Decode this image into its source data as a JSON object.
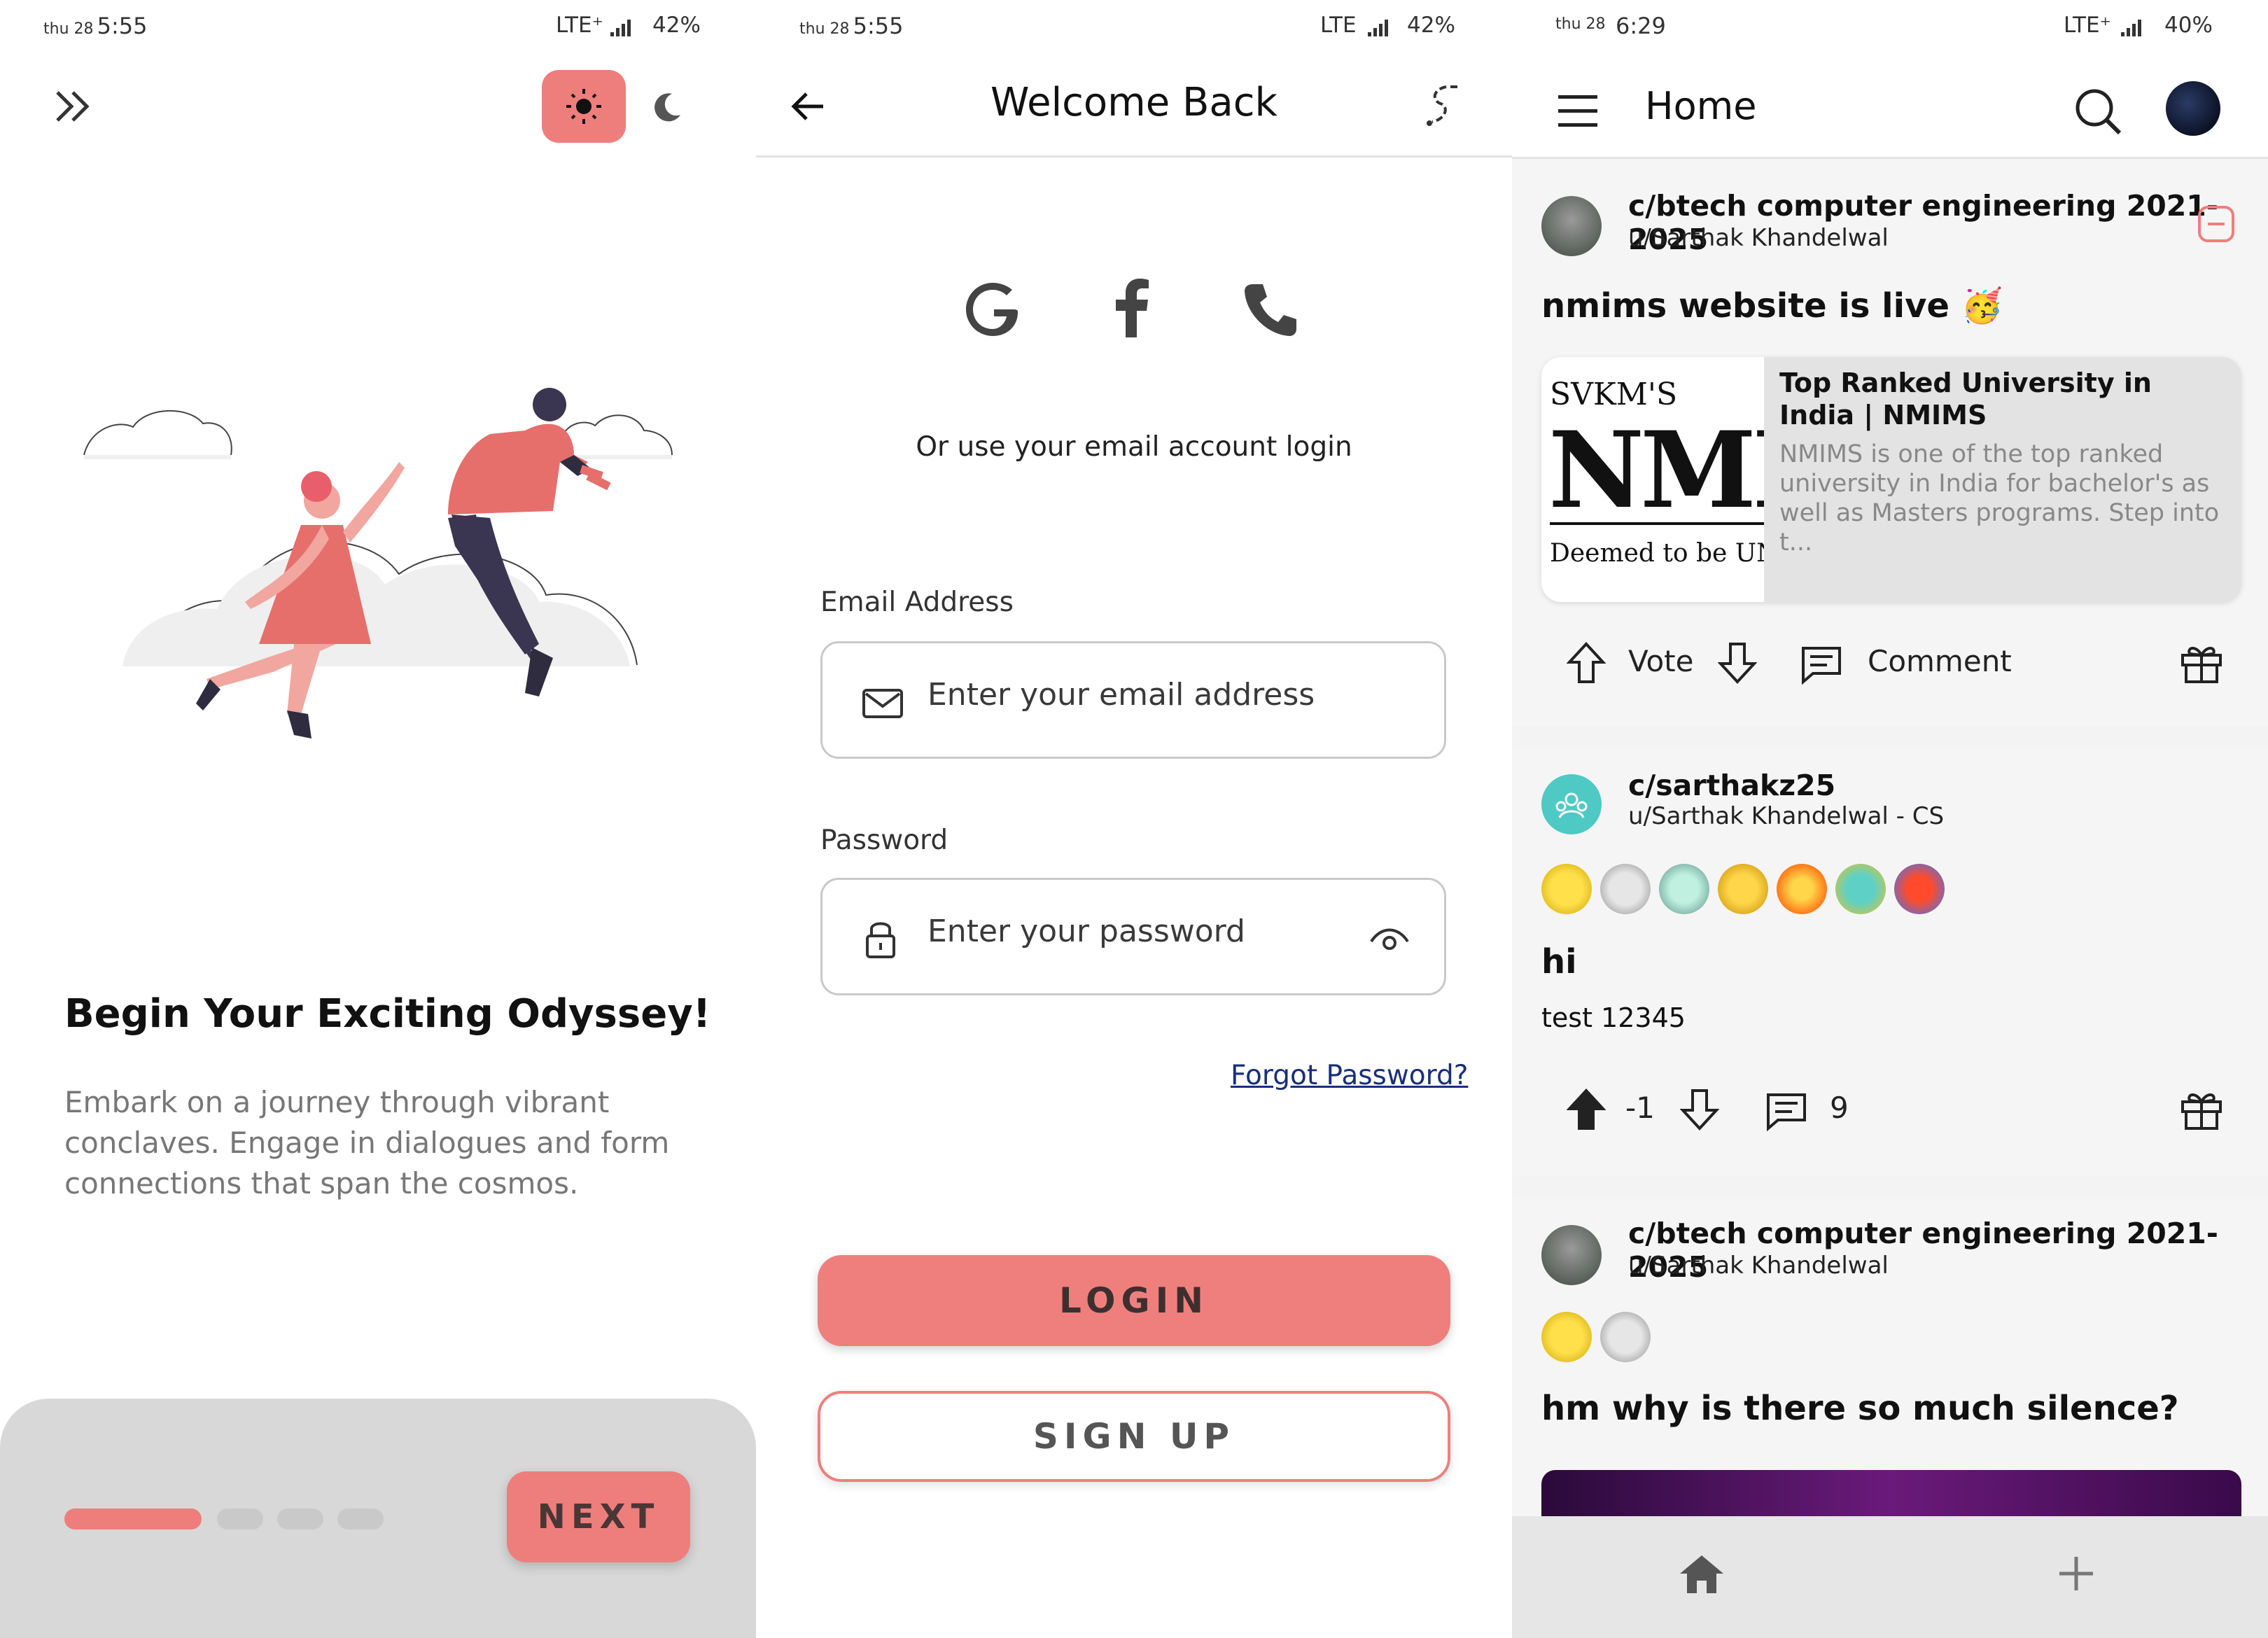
{
  "colors": {
    "accent": "#ee7e7c",
    "dark": "#111111",
    "muted": "#777777",
    "link": "#1a2f7a",
    "panel3_bg": "#f3f3f3"
  },
  "screen1": {
    "status": {
      "day": "thu 28",
      "time": "5:55",
      "network": "LTE⁺",
      "battery": "42%"
    },
    "icons": {
      "skip": "double-chevron-right-icon",
      "light": "sun-icon",
      "dark": "moon-icon"
    },
    "title": "Begin Your Exciting Odyssey!",
    "body_lines": [
      "Embark on a journey through vibrant",
      "conclaves. Engage in dialogues and form",
      "connections that span the cosmos."
    ],
    "pager": {
      "count": 4,
      "active": 0
    },
    "next_label": "NEXT"
  },
  "screen2": {
    "status": {
      "day": "thu 28",
      "time": "5:55",
      "network": "LTE",
      "battery": "42%"
    },
    "title": "Welcome Back",
    "icons": {
      "back": "arrow-left-icon",
      "route": "route-icon",
      "google": "google-icon",
      "facebook": "facebook-icon",
      "phone": "phone-icon",
      "mail": "mail-icon",
      "lock": "lock-icon",
      "eye": "eye-icon"
    },
    "alt_login": "Or use your email account login",
    "email_label": "Email Address",
    "email_placeholder": "Enter your email address",
    "password_label": "Password",
    "password_placeholder": "Enter your password",
    "forgot": "Forgot Password?",
    "login_label": "LOGIN",
    "signup_label": "SIGN UP"
  },
  "screen3": {
    "status": {
      "day": "thu 28",
      "time": "6:29",
      "network": "LTE⁺",
      "battery": "40%"
    },
    "title": "Home",
    "icons": {
      "menu": "menu-icon",
      "search": "search-icon",
      "avatar": "profile-avatar",
      "home": "home-icon",
      "add": "plus-icon",
      "upvote": "arrow-up-icon",
      "downvote": "arrow-down-icon",
      "comment": "comment-icon",
      "gift": "gift-icon",
      "option": "minus-square-icon"
    },
    "posts": [
      {
        "community": "c/btech computer engineering 2021-2025",
        "user": "u/Sarthak Khandelwal",
        "title": "nmims website is live 🥳",
        "link": {
          "logo_lines": [
            "SVKM'S",
            "NMI",
            "Deemed to be UNI"
          ],
          "title": "Top Ranked University in India | NMIMS",
          "desc": "NMIMS is one of the top ranked university in India for bachelor's as well as Masters programs. Step into t..."
        },
        "vote_label": "Vote",
        "comment_label": "Comment"
      },
      {
        "community": "c/sarthakz25",
        "user": "u/Sarthak Khandelwal - CS",
        "title": "hi",
        "body": "test 12345",
        "score": "-1",
        "comments": "9"
      },
      {
        "community": "c/btech computer engineering 2021-2025",
        "user": "u/Sarthak Khandelwal",
        "title": "hm why is there so much silence?"
      }
    ]
  }
}
